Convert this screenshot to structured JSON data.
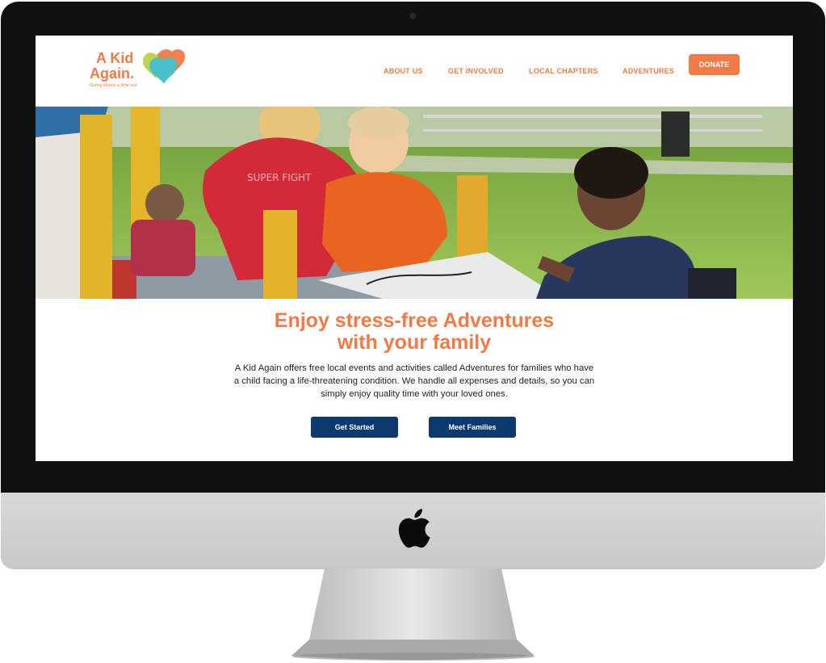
{
  "logo": {
    "line1": "A Kid",
    "line2": "Again.",
    "tagline": "Giving illness a time out",
    "balloon_colors": [
      "#bcd14a",
      "#f07b46",
      "#49c0c9"
    ]
  },
  "nav": {
    "items": [
      {
        "label": "ABOUT US"
      },
      {
        "label": "GET INVOLVED"
      },
      {
        "label": "LOCAL CHAPTERS"
      },
      {
        "label": "ADVENTURES"
      }
    ],
    "donate_label": "DONATE"
  },
  "hero": {
    "description": "Children playing at a playground"
  },
  "content": {
    "headline_line1": "Enjoy stress-free Adventures",
    "headline_line2": "with your family",
    "body": "A Kid Again offers free local events and activities called Adventures for families who have a child facing a life-threatening condition. We handle all expenses and details, so you can simply enjoy quality time with your loved ones."
  },
  "buttons": {
    "get_started": "Get Started",
    "meet_families": "Meet Families"
  },
  "colors": {
    "accent": "#f07b46",
    "button": "#0d3a6e",
    "bezel": "#111111"
  }
}
